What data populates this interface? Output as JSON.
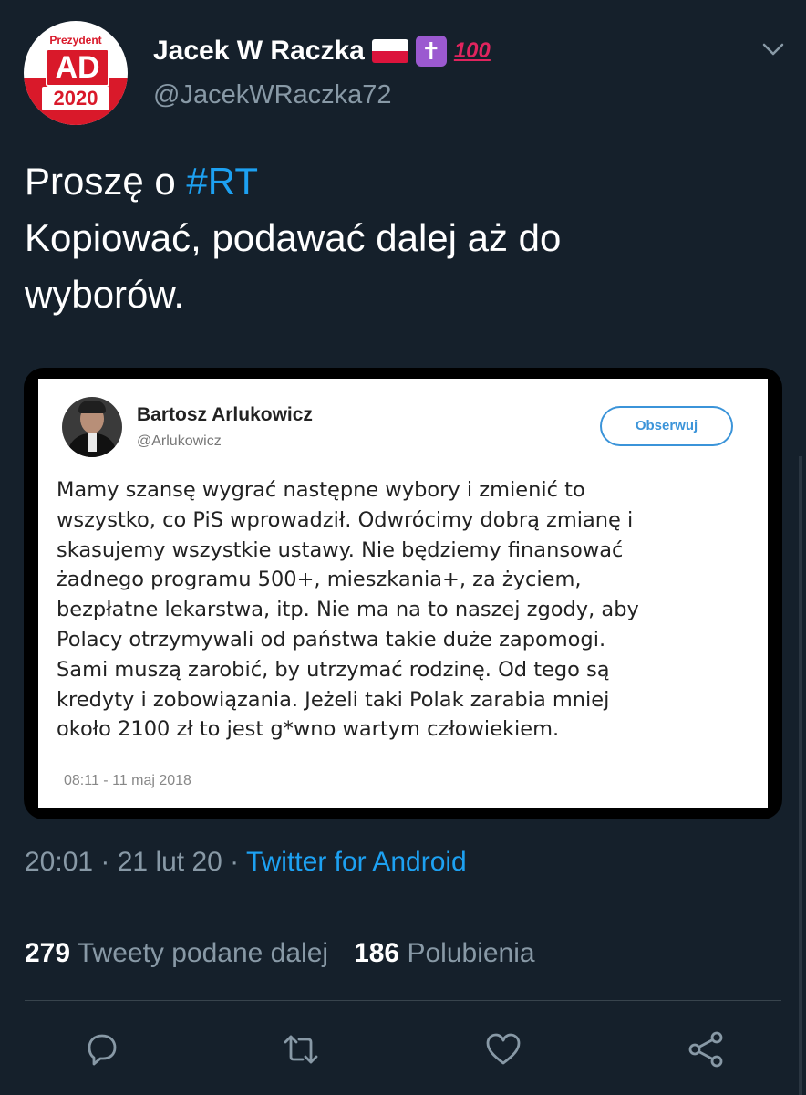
{
  "author": {
    "avatar_text_top": "Prezydent",
    "avatar_text_mid": "AD",
    "avatar_text_year": "2020",
    "display_name": "Jacek W Raczka",
    "handle": "@JacekWRaczka72",
    "emoji_hundred": "100"
  },
  "tweet": {
    "line1_prefix": "Proszę o ",
    "hashtag": "#RT",
    "line2": "Kopiować, podawać dalej aż do",
    "line3": "wyborów."
  },
  "embedded": {
    "name": "Bartosz Arlukowicz",
    "handle": "@Arlukowicz",
    "follow_label": "Obserwuj",
    "text": "Mamy szansę wygrać następne wybory i zmienić to\nwszystko, co PiS wprowadził. Odwrócimy dobrą zmianę i\nskasujemy wszystkie ustawy. Nie będziemy finansować\nżadnego programu 500+, mieszkania+, za życiem,\nbezpłatne lekarstwa, itp. Nie ma na to naszej zgody, aby\nPolacy otrzymywali od państwa takie duże zapomogi.\nSami muszą zarobić, by utrzymać rodzinę. Od tego są\nkredyty i zobowiązania. Jeżeli taki Polak zarabia mniej\nokoło 2100 zł to jest g*wno wartym człowiekiem.",
    "timestamp": "08:11 - 11 maj 2018"
  },
  "meta": {
    "time": "20:01",
    "sep1": " · ",
    "date": "21 lut 20",
    "sep2": " · ",
    "source": "Twitter for Android"
  },
  "stats": {
    "retweets_count": "279",
    "retweets_label": "Tweety podane dalej",
    "likes_count": "186",
    "likes_label": "Polubienia"
  },
  "actions": {
    "icons": [
      "reply-icon",
      "retweet-icon",
      "like-icon",
      "share-icon"
    ]
  },
  "colors": {
    "background": "#15202b",
    "accent": "#1da1f2",
    "muted": "#8899a6"
  }
}
